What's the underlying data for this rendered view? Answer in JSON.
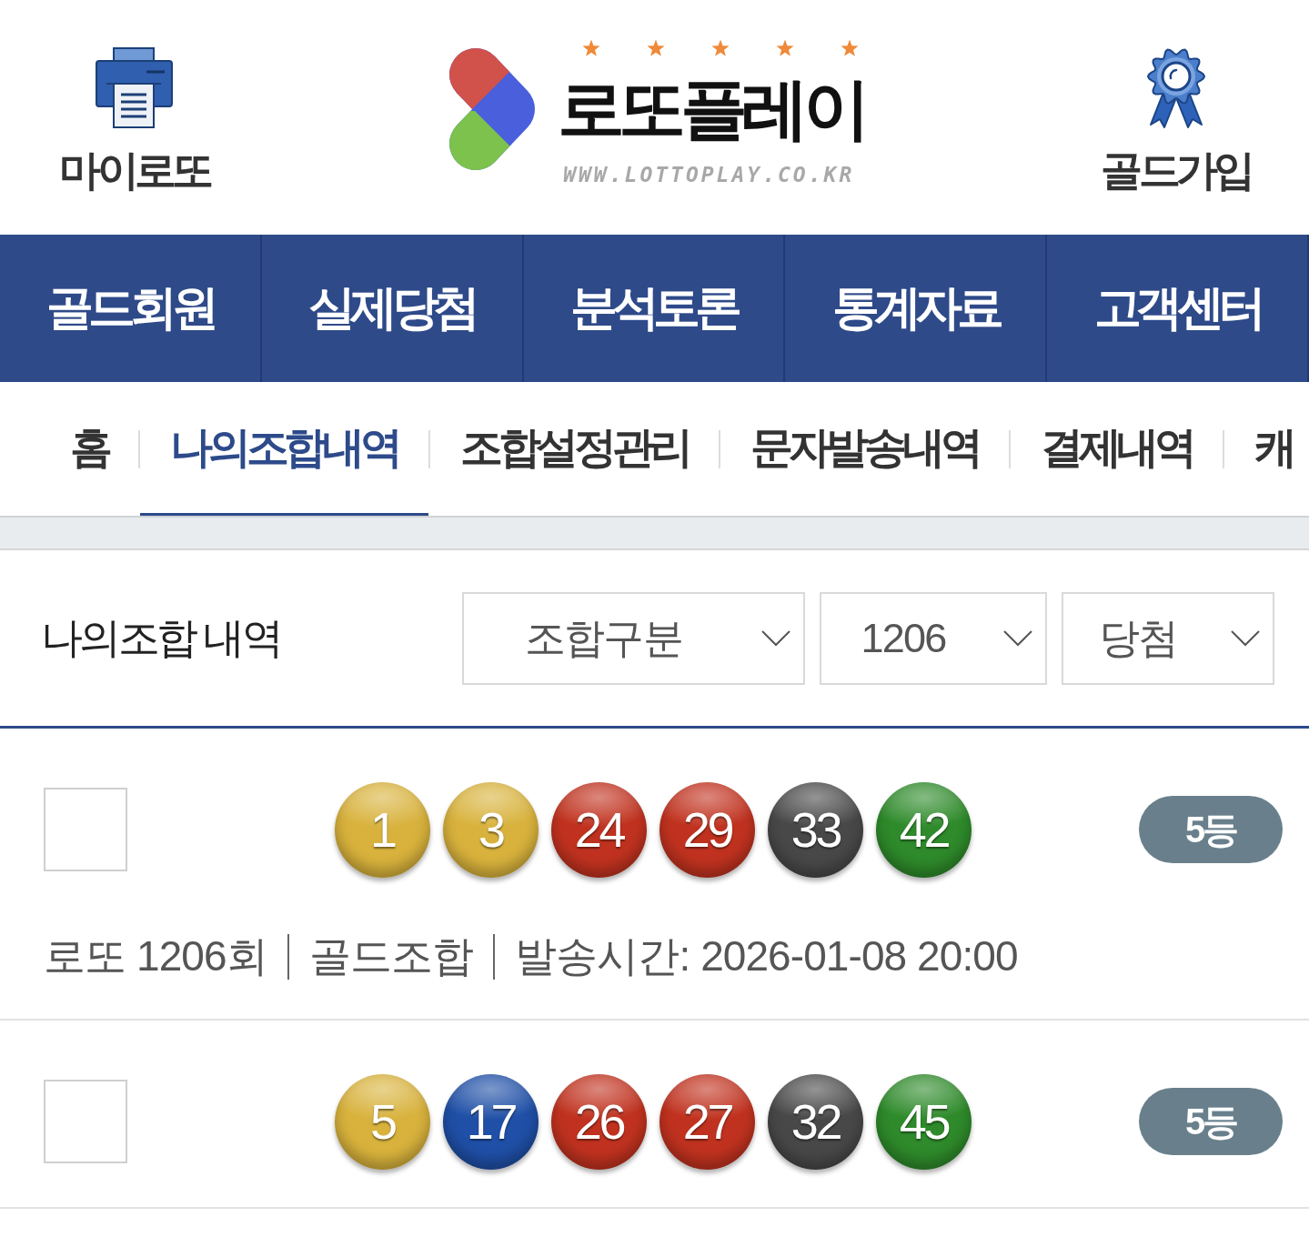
{
  "header": {
    "left_link": {
      "label": "마이로또"
    },
    "logo": {
      "title": "로또플레이",
      "url": "WWW.LOTTOPLAY.CO.KR"
    },
    "right_link": {
      "label": "골드가입"
    }
  },
  "main_nav": [
    {
      "label": "골드회원"
    },
    {
      "label": "실제당첨"
    },
    {
      "label": "분석토론"
    },
    {
      "label": "통계자료"
    },
    {
      "label": "고객센터"
    }
  ],
  "sub_tabs": [
    {
      "label": "홈",
      "selected": false
    },
    {
      "label": "나의조합내역",
      "selected": true
    },
    {
      "label": "조합설정관리",
      "selected": false
    },
    {
      "label": "문자발송내역",
      "selected": false
    },
    {
      "label": "결제내역",
      "selected": false
    },
    {
      "label": "캐",
      "selected": false
    }
  ],
  "filter": {
    "title": "나의조합 내역",
    "selects": [
      {
        "value": "조합구분"
      },
      {
        "value": "1206"
      },
      {
        "value": "당첨"
      }
    ]
  },
  "rows": [
    {
      "checked": false,
      "balls": [
        {
          "number": "1",
          "color": "#d8b23c"
        },
        {
          "number": "3",
          "color": "#d8b23c"
        },
        {
          "number": "24",
          "color": "#c0321f"
        },
        {
          "number": "29",
          "color": "#c0321f"
        },
        {
          "number": "33",
          "color": "#484848"
        },
        {
          "number": "42",
          "color": "#2e8a2a"
        }
      ],
      "rank": "5등",
      "round": "로또 1206회",
      "combo_type": "골드조합",
      "sent_time": "발송시간: 2026-01-08 20:00"
    },
    {
      "checked": false,
      "balls": [
        {
          "number": "5",
          "color": "#d8b23c"
        },
        {
          "number": "17",
          "color": "#1f4fa6"
        },
        {
          "number": "26",
          "color": "#c0321f"
        },
        {
          "number": "27",
          "color": "#c0321f"
        },
        {
          "number": "32",
          "color": "#484848"
        },
        {
          "number": "45",
          "color": "#2e8a2a"
        }
      ],
      "rank": "5등"
    }
  ]
}
